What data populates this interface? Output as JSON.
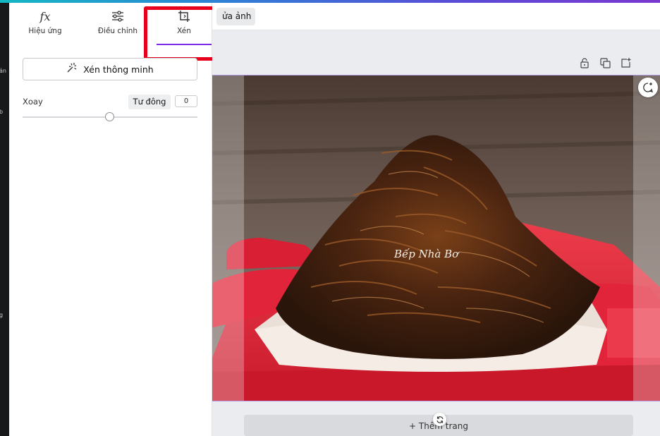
{
  "left_rail": {
    "labels": [
      "ản",
      "b",
      "g"
    ]
  },
  "panel": {
    "tabs": [
      {
        "label": "Hiệu ứng",
        "icon": "fx-icon"
      },
      {
        "label": "Điều chỉnh",
        "icon": "sliders-icon"
      },
      {
        "label": "Xén",
        "icon": "crop-icon",
        "active": true
      }
    ],
    "smart_crop_label": "Xén thông minh",
    "rotate": {
      "label": "Xoay",
      "auto_label": "Tư đông",
      "value": "0",
      "slider_level": 0.5
    }
  },
  "topbar": {
    "edit_label": "ửa ảnh"
  },
  "page": {
    "icons": [
      "lock-icon",
      "duplicate-icon",
      "add-page-icon"
    ],
    "add_page_label": "+ Thêm trang"
  },
  "photo": {
    "watermark": "Bếp Nhà Bơ"
  },
  "colors": {
    "accent": "#7d2ae8",
    "highlight_box": "#e8001c",
    "dish_red": "#e2243a"
  }
}
